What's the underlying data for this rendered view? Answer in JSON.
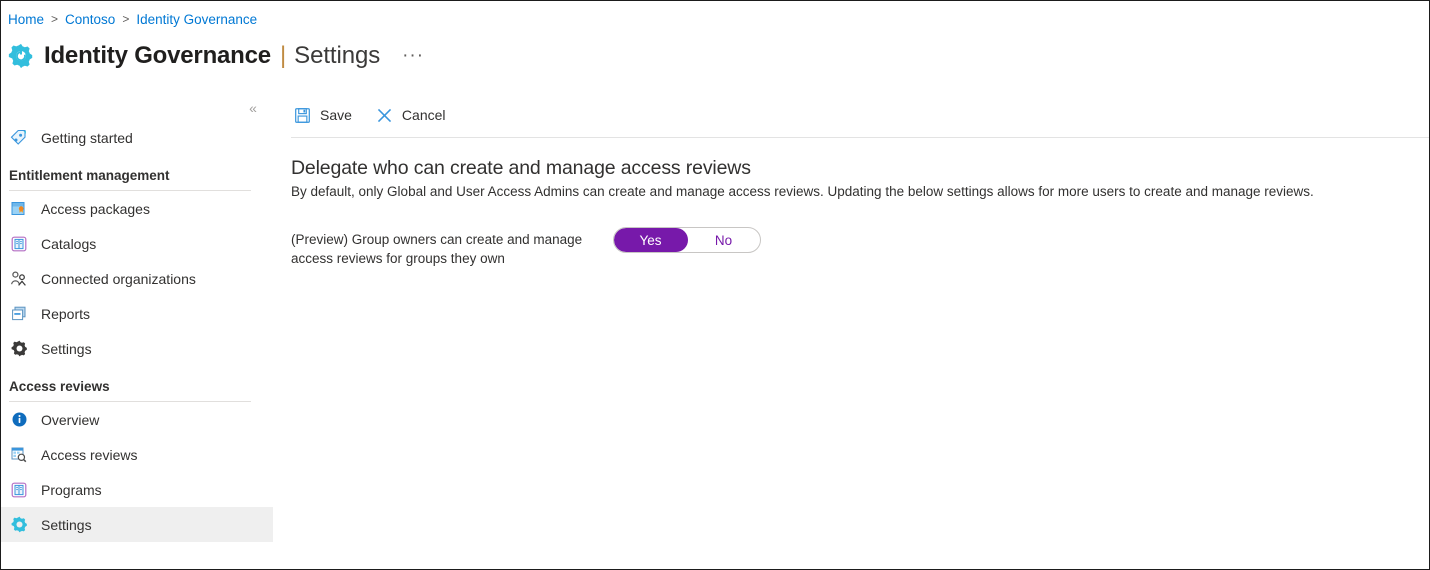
{
  "breadcrumb": {
    "items": [
      "Home",
      "Contoso",
      "Identity Governance"
    ],
    "separator": ">"
  },
  "header": {
    "icon": "gear-icon",
    "title": "Identity Governance",
    "pipe": "|",
    "subtitle": "Settings",
    "more_label": "···",
    "accent_cyan": "#32bedd",
    "accent_pipe": "#c08b42"
  },
  "sidebar": {
    "collapse_label": "«",
    "top_items": [
      {
        "label": "Getting started",
        "icon": "rocket-icon",
        "selected": false
      }
    ],
    "sections": [
      {
        "label": "Entitlement management",
        "items": [
          {
            "label": "Access packages",
            "icon": "package-icon",
            "selected": false
          },
          {
            "label": "Catalogs",
            "icon": "book-icon",
            "selected": false
          },
          {
            "label": "Connected organizations",
            "icon": "people-icon",
            "selected": false
          },
          {
            "label": "Reports",
            "icon": "report-icon",
            "selected": false
          },
          {
            "label": "Settings",
            "icon": "gear-dark-icon",
            "selected": false
          }
        ]
      },
      {
        "label": "Access reviews",
        "items": [
          {
            "label": "Overview",
            "icon": "info-icon",
            "selected": false
          },
          {
            "label": "Access reviews",
            "icon": "review-search-icon",
            "selected": false
          },
          {
            "label": "Programs",
            "icon": "book-icon",
            "selected": false
          },
          {
            "label": "Settings",
            "icon": "gear-cyan-icon",
            "selected": true
          }
        ]
      }
    ],
    "selected_bg": "#efefef"
  },
  "toolbar": {
    "save_label": "Save",
    "save_icon": "save-disk-icon",
    "cancel_label": "Cancel",
    "cancel_icon": "close-x-icon"
  },
  "content": {
    "heading": "Delegate who can create and manage access reviews",
    "description": "By default, only Global and User Access Admins can create and manage access reviews. Updating the below settings allows for more users to create and manage reviews.",
    "setting": {
      "label": "(Preview) Group owners can create and manage access reviews for groups they own",
      "toggle": {
        "on_label": "Yes",
        "off_label": "No",
        "value": "Yes",
        "on_color": "#7719aa"
      }
    }
  }
}
